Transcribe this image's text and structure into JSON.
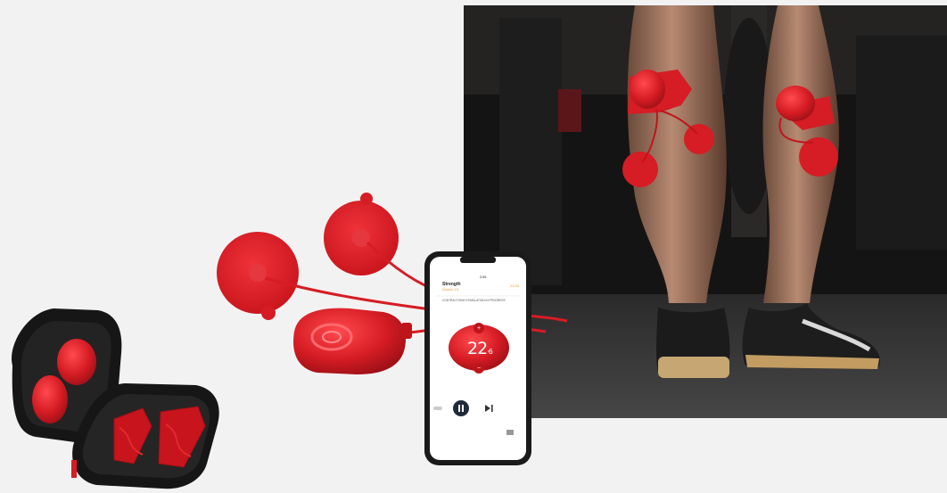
{
  "phone": {
    "status_time": "2:55",
    "program_title": "Strength",
    "program_subtitle": "Session 1/3",
    "timer": "23:35",
    "message": "CONTRACTIONS STIMULATION IN PROGRESS",
    "intensity_main": "22",
    "intensity_sub": "6"
  },
  "colors": {
    "accent": "#d61c24",
    "background": "#f3f2f2",
    "photo_bg": "#141313"
  },
  "icons": [
    "pause-icon",
    "skip-next-icon",
    "plus-icon",
    "minus-icon",
    "settings-icon"
  ]
}
